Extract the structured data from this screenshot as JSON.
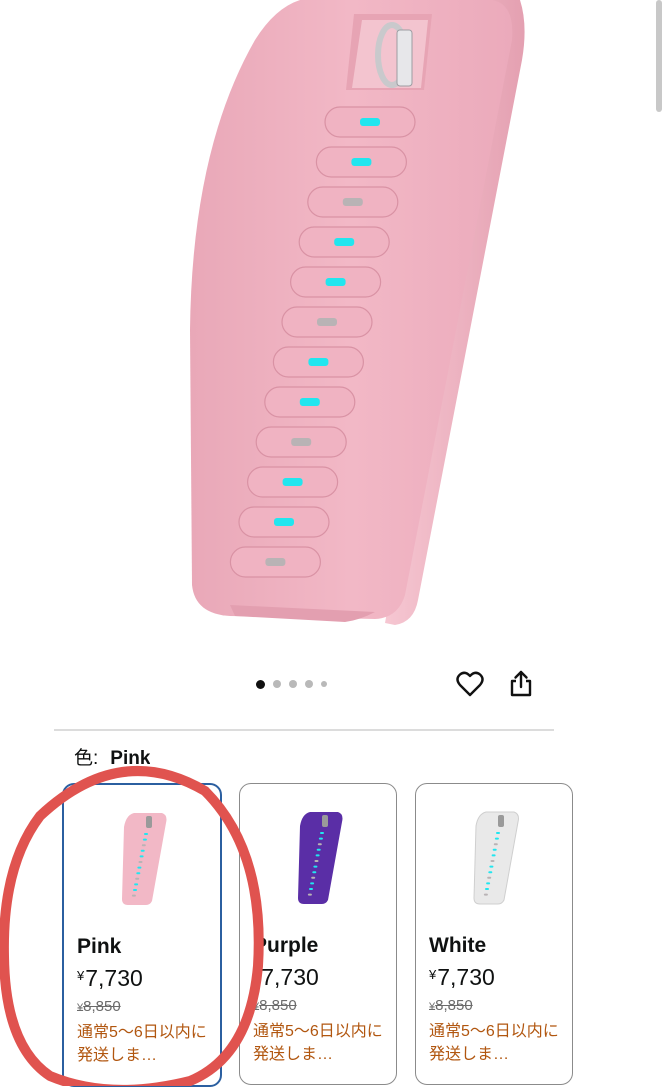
{
  "carousel": {
    "dot_count": 5,
    "active_index": 0
  },
  "icons": {
    "wishlist": "heart-icon",
    "share": "share-icon"
  },
  "color_selector": {
    "label": "色:",
    "selected_value": "Pink"
  },
  "variants": [
    {
      "name": "Pink",
      "currency": "¥",
      "price": "7,730",
      "list_price_currency": "¥",
      "list_price": "8,850",
      "shipping": "通常5～6日以内に発送しま…",
      "selected": true,
      "color": "#f2b8c6"
    },
    {
      "name": "Purple",
      "currency": "¥",
      "price": "7,730",
      "list_price_currency": "¥",
      "list_price": "8,850",
      "shipping": "通常5～6日以内に発送しま…",
      "selected": false,
      "color": "#5a2ea6"
    },
    {
      "name": "White",
      "currency": "¥",
      "price": "7,730",
      "list_price_currency": "¥",
      "list_price": "8,850",
      "shipping": "通常5～6日以内に発送しま…",
      "selected": false,
      "color": "#e9e9e9"
    }
  ],
  "colors": {
    "product_pink": "#f2b8c6",
    "led_on": "#21e6ef",
    "led_off": "#b9b3b5",
    "selected_border": "#2b5fa0",
    "shipping_text": "#b1560f",
    "annotation_circle": "#e0534f"
  }
}
